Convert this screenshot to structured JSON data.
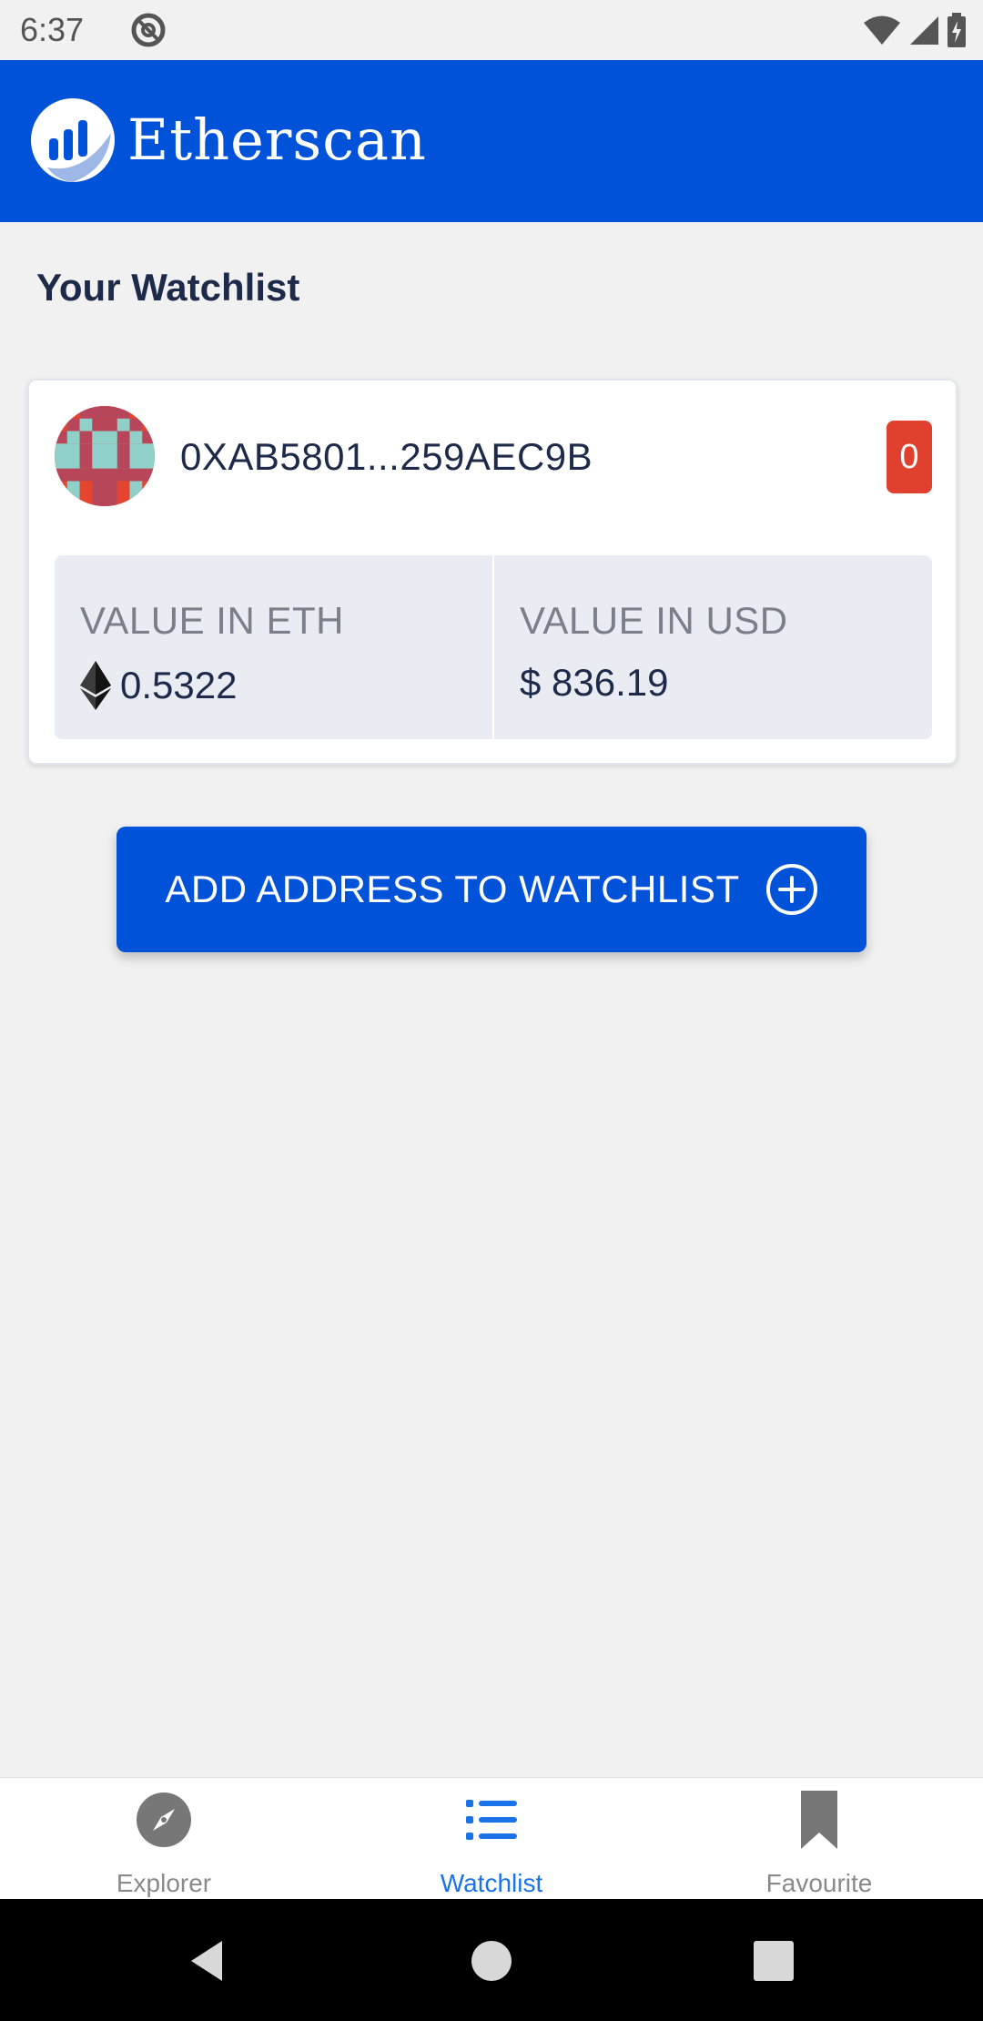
{
  "status_bar": {
    "time": "6:37",
    "icons": [
      "at-sign-icon",
      "wifi-icon",
      "cell-signal-icon",
      "battery-charging-icon"
    ]
  },
  "app_bar": {
    "logo_text": "Etherscan",
    "logo_icon": "etherscan-logo-icon",
    "color": "#0052d9"
  },
  "page": {
    "title": "Your Watchlist"
  },
  "watchlist": [
    {
      "address": "0XAB5801...259AEC9B",
      "tx_count": "0",
      "value_eth_label": "VALUE IN ETH",
      "value_eth": "0.5322",
      "value_usd_label": "VALUE IN USD",
      "value_usd": "$ 836.19",
      "badge_color": "#e0402e"
    }
  ],
  "add_button": {
    "label": "ADD ADDRESS TO WATCHLIST",
    "icon": "plus-circle-icon"
  },
  "bottom_nav": {
    "items": [
      {
        "label": "Explorer",
        "icon": "compass-icon",
        "active": false
      },
      {
        "label": "Watchlist",
        "icon": "list-icon",
        "active": true
      },
      {
        "label": "Favourite",
        "icon": "bookmark-icon",
        "active": false
      }
    ],
    "active_color": "#1a73e8"
  },
  "system_nav": {
    "icons": [
      "back-icon",
      "home-icon",
      "recents-icon"
    ]
  }
}
